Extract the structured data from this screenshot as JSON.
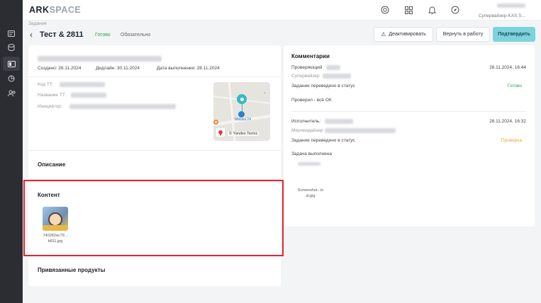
{
  "app": {
    "logo_main": "ARK",
    "logo_accent": "SPACE",
    "user_name": "Супервайзер-KAS S..."
  },
  "header_icons": [
    "support-icon",
    "grid-icon",
    "bell-icon",
    "compass-icon"
  ],
  "breadcrumb": "Задания",
  "task": {
    "title": "Тест & 2811",
    "status": "Готово",
    "required": "Обязательно"
  },
  "actions": {
    "deactivate": "Деактивировать",
    "return": "Вернуть в работу",
    "confirm": "Подтвердить"
  },
  "info": {
    "created": "Создано: 28.11.2024",
    "deadline": "Дедлайн: 30.11.2024",
    "completed": "Дата выполнения: 28.11.2024",
    "code_label": "Код ТТ:",
    "name_label": "Название ТТ:",
    "initiator_label": "Инициатор:"
  },
  "map": {
    "place_label": "Мишка 24",
    "attribution": "© Yandex Terms"
  },
  "sections": {
    "description": "Описание",
    "content": "Контент",
    "products": "Привязанные продукты"
  },
  "content_file": {
    "line1": "740282ac79...",
    "line2": "b811.jpg"
  },
  "comments": {
    "title": "Комментарии",
    "reviewer_label": "Проверяющий",
    "reviewer_date": "28.11.2024, 16:44",
    "reviewer_role": "Супервайзер",
    "status_changed_1": "Задание переведено в статус",
    "status_1": "Готово",
    "note_1": "Проверил - всё ОК",
    "executor_label": "Исполнитель:",
    "executor_date": "28.11.2024, 16:32",
    "executor_role": "Мерчендайзер",
    "status_changed_2": "Задание переведено в статус",
    "status_2": "Проверка",
    "note_2": "Задача выполнена",
    "file_line1": "Screenshot...in",
    "file_line2": "al.jpg"
  },
  "colors": {
    "accent": "#7dd3dc",
    "status_green": "#27a44a",
    "status_orange": "#f0a030",
    "highlight": "#e3242b"
  }
}
